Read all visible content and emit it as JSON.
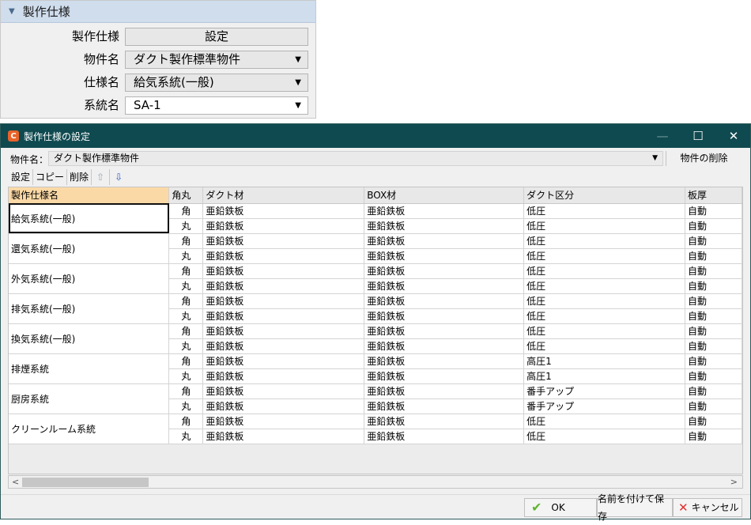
{
  "panel": {
    "header": "製作仕様",
    "rows": [
      {
        "label": "製作仕様",
        "value": "設定"
      },
      {
        "label": "物件名",
        "value": "ダクト製作標準物件"
      },
      {
        "label": "仕様名",
        "value": "給気系統(一般)"
      },
      {
        "label": "系統名",
        "value": "SA-1"
      }
    ]
  },
  "dialog": {
    "title": "製作仕様の設定",
    "bukken_label": "物件名：",
    "bukken_value": "ダクト製作標準物件",
    "delete_bukken": "物件の削除",
    "toolbar": {
      "set": "設定",
      "copy": "コピー",
      "delete": "削除",
      "up_icon": "arrow-up-icon",
      "down_icon": "arrow-down-icon"
    },
    "columns": [
      "製作仕様名",
      "角丸",
      "ダクト材",
      "BOX材",
      "ダクト区分",
      "板厚"
    ],
    "rows": [
      {
        "name": "給気系統(一般)",
        "lines": [
          [
            "角",
            "亜鉛鉄板",
            "亜鉛鉄板",
            "低圧",
            "自動"
          ],
          [
            "丸",
            "亜鉛鉄板",
            "亜鉛鉄板",
            "低圧",
            "自動"
          ]
        ]
      },
      {
        "name": "還気系統(一般)",
        "lines": [
          [
            "角",
            "亜鉛鉄板",
            "亜鉛鉄板",
            "低圧",
            "自動"
          ],
          [
            "丸",
            "亜鉛鉄板",
            "亜鉛鉄板",
            "低圧",
            "自動"
          ]
        ]
      },
      {
        "name": "外気系統(一般)",
        "lines": [
          [
            "角",
            "亜鉛鉄板",
            "亜鉛鉄板",
            "低圧",
            "自動"
          ],
          [
            "丸",
            "亜鉛鉄板",
            "亜鉛鉄板",
            "低圧",
            "自動"
          ]
        ]
      },
      {
        "name": "排気系統(一般)",
        "lines": [
          [
            "角",
            "亜鉛鉄板",
            "亜鉛鉄板",
            "低圧",
            "自動"
          ],
          [
            "丸",
            "亜鉛鉄板",
            "亜鉛鉄板",
            "低圧",
            "自動"
          ]
        ]
      },
      {
        "name": "換気系統(一般)",
        "lines": [
          [
            "角",
            "亜鉛鉄板",
            "亜鉛鉄板",
            "低圧",
            "自動"
          ],
          [
            "丸",
            "亜鉛鉄板",
            "亜鉛鉄板",
            "低圧",
            "自動"
          ]
        ]
      },
      {
        "name": "排煙系統",
        "lines": [
          [
            "角",
            "亜鉛鉄板",
            "亜鉛鉄板",
            "高圧1",
            "自動"
          ],
          [
            "丸",
            "亜鉛鉄板",
            "亜鉛鉄板",
            "高圧1",
            "自動"
          ]
        ]
      },
      {
        "name": "厨房系統",
        "lines": [
          [
            "角",
            "亜鉛鉄板",
            "亜鉛鉄板",
            "番手アップ",
            "自動"
          ],
          [
            "丸",
            "亜鉛鉄板",
            "亜鉛鉄板",
            "番手アップ",
            "自動"
          ]
        ]
      },
      {
        "name": "クリーンルーム系統",
        "lines": [
          [
            "角",
            "亜鉛鉄板",
            "亜鉛鉄板",
            "低圧",
            "自動"
          ],
          [
            "丸",
            "亜鉛鉄板",
            "亜鉛鉄板",
            "低圧",
            "自動"
          ]
        ]
      }
    ],
    "buttons": {
      "ok": "OK",
      "save_as": "名前を付けて保存",
      "cancel": "キャンセル"
    }
  }
}
